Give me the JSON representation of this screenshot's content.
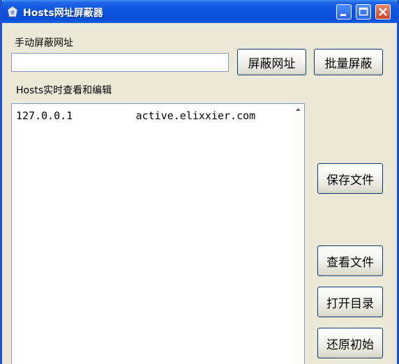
{
  "window": {
    "title": "Hosts网址屏蔽器"
  },
  "block": {
    "label": "手动屏蔽网址",
    "input_value": "",
    "block_button": "屏蔽网址",
    "batch_button": "批量屏蔽"
  },
  "hosts": {
    "label": "Hosts实时查看和编辑",
    "content": "127.0.0.1          active.elixxier.com"
  },
  "actions": {
    "save": "保存文件",
    "view": "查看文件",
    "open_dir": "打开目录",
    "restore": "还原初始"
  }
}
